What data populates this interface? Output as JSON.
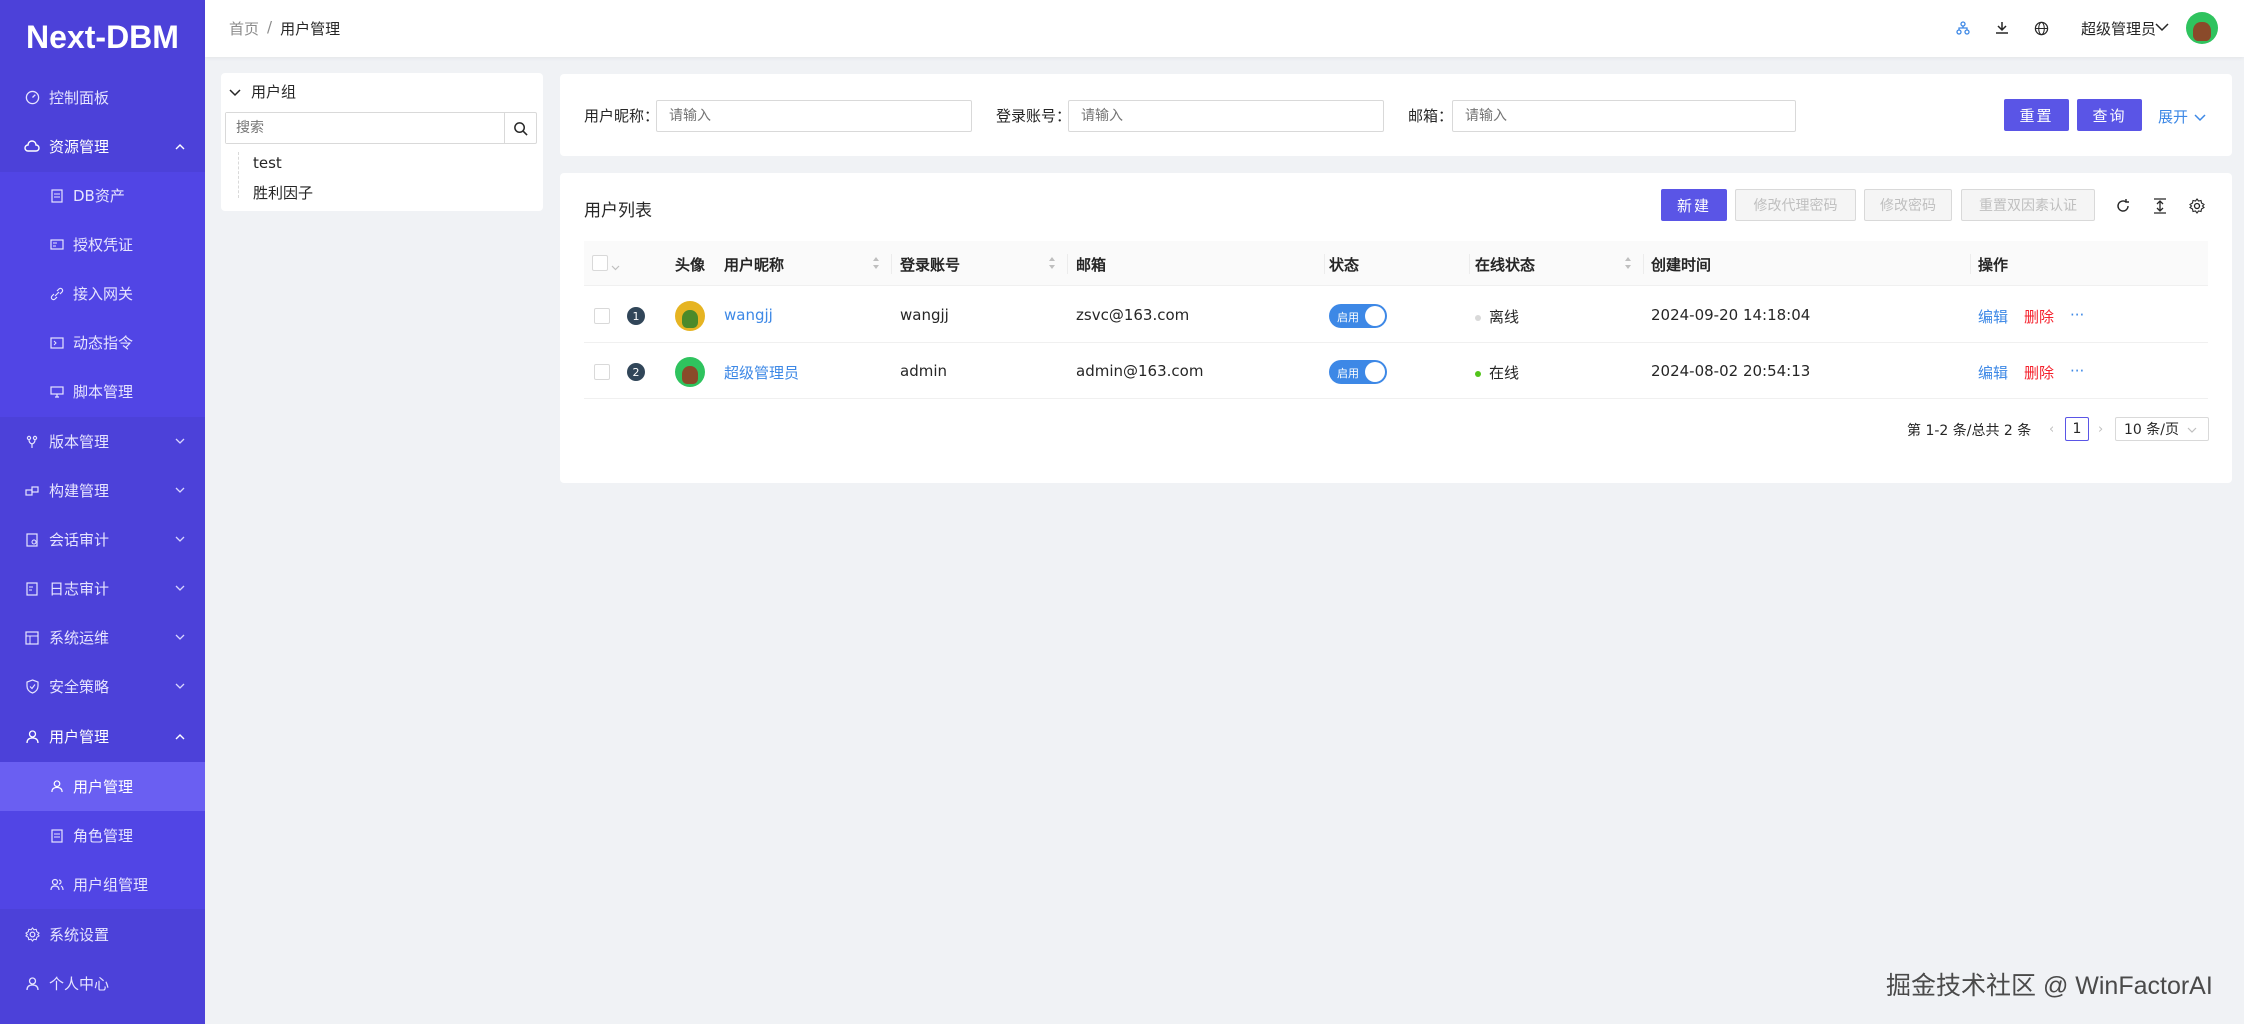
{
  "app": {
    "logo": "Next-DBM"
  },
  "sidebar": {
    "items": [
      {
        "label": "控制面板",
        "icon": "dashboard-icon"
      },
      {
        "label": "资源管理",
        "icon": "cloud-icon",
        "expanded": true
      },
      {
        "label": "DB资产",
        "icon": "file-icon"
      },
      {
        "label": "授权凭证",
        "icon": "id-card-icon"
      },
      {
        "label": "接入网关",
        "icon": "link-icon"
      },
      {
        "label": "动态指令",
        "icon": "code-icon"
      },
      {
        "label": "脚本管理",
        "icon": "desktop-icon"
      },
      {
        "label": "版本管理",
        "icon": "branch-icon"
      },
      {
        "label": "构建管理",
        "icon": "build-icon"
      },
      {
        "label": "会话审计",
        "icon": "audit-icon"
      },
      {
        "label": "日志审计",
        "icon": "log-icon"
      },
      {
        "label": "系统运维",
        "icon": "ops-icon"
      },
      {
        "label": "安全策略",
        "icon": "shield-icon"
      },
      {
        "label": "用户管理",
        "icon": "user-icon",
        "expanded": true
      },
      {
        "label": "用户管理",
        "icon": "user-icon",
        "active": true
      },
      {
        "label": "角色管理",
        "icon": "file-icon"
      },
      {
        "label": "用户组管理",
        "icon": "team-icon"
      },
      {
        "label": "系统设置",
        "icon": "gear-icon"
      },
      {
        "label": "个人中心",
        "icon": "user-icon"
      }
    ]
  },
  "header": {
    "breadcrumb": {
      "home": "首页",
      "sep": "/",
      "current": "用户管理"
    },
    "user_name": "超级管理员"
  },
  "group_panel": {
    "title": "用户组",
    "search_placeholder": "搜索",
    "groups": [
      "test",
      "胜利因子"
    ]
  },
  "filters": {
    "nickname_label": "用户昵称：",
    "account_label": "登录账号：",
    "email_label": "邮箱：",
    "placeholder": "请输入",
    "reset_label": "重置",
    "query_label": "查询",
    "expand_label": "展开"
  },
  "table": {
    "title": "用户列表",
    "buttons": {
      "new": "新建",
      "proxy_pwd": "修改代理密码",
      "pwd": "修改密码",
      "reset_2fa": "重置双因素认证"
    },
    "columns": [
      "头像",
      "用户昵称",
      "登录账号",
      "邮箱",
      "状态",
      "在线状态",
      "创建时间",
      "操作"
    ],
    "rows": [
      {
        "index": "1",
        "nickname": "wangjj",
        "account": "wangjj",
        "email": "zsvc@163.com",
        "status": "启用",
        "online": "离线",
        "online_color": "#d9d9d9",
        "created": "2024-09-20 14:18:04",
        "edit": "编辑",
        "delete": "删除",
        "more": "···"
      },
      {
        "index": "2",
        "nickname": "超级管理员",
        "account": "admin",
        "email": "admin@163.com",
        "status": "启用",
        "online": "在线",
        "online_color": "#52c41a",
        "created": "2024-08-02 20:54:13",
        "edit": "编辑",
        "delete": "删除",
        "more": "···"
      }
    ],
    "pagination": {
      "summary": "第 1-2 条/总共 2 条",
      "current_page": "1",
      "page_size": "10 条/页"
    }
  },
  "watermark": "掘金技术社区 @ WinFactorAI",
  "colors": {
    "sidebar": "#4c41d9",
    "primary": "#5a55e6",
    "link": "#3d88e6",
    "danger": "#f5222d"
  }
}
